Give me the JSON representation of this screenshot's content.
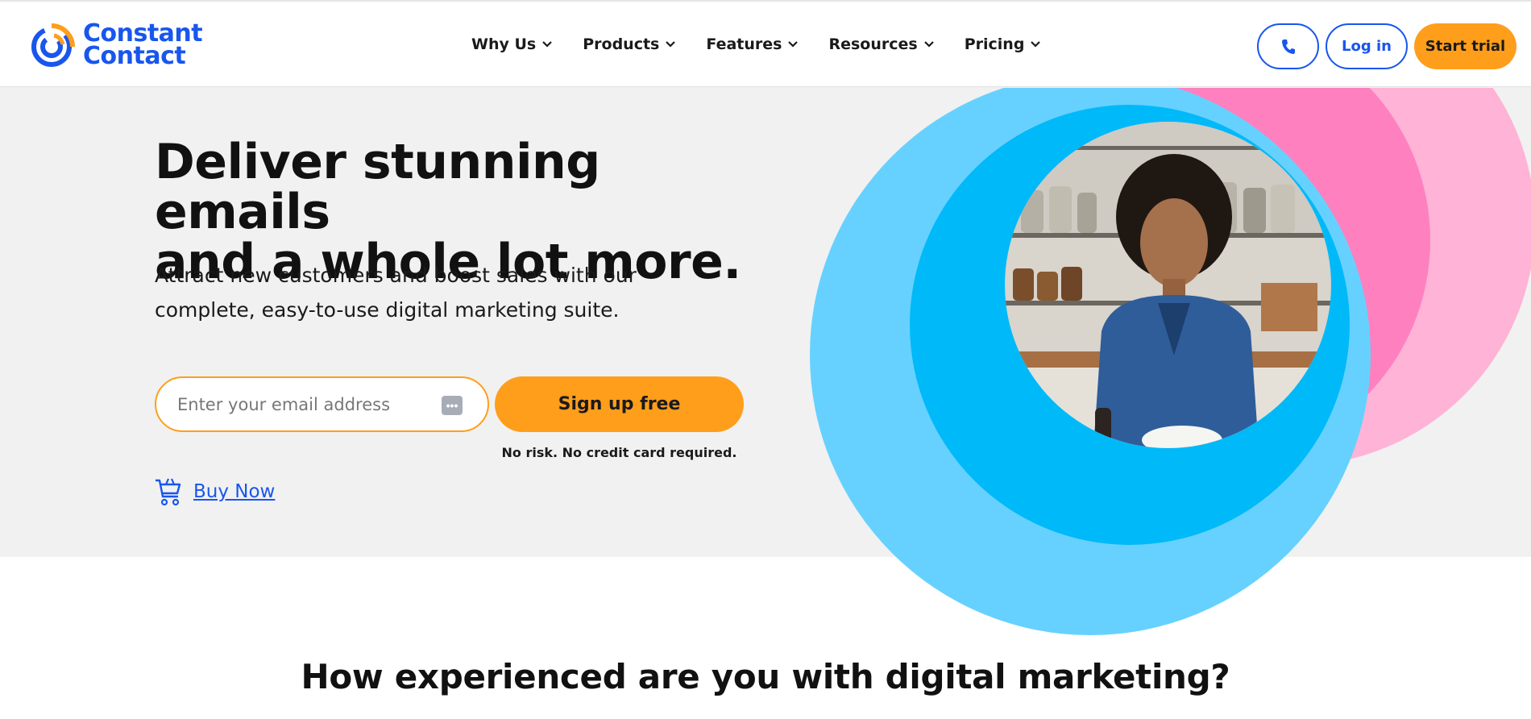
{
  "brand": {
    "name_line1": "Constant",
    "name_line2": "Contact",
    "colors": {
      "blue": "#1856ed",
      "orange": "#ff9e1b",
      "pink": "#ff80bf",
      "light_pink": "#ffb3d6",
      "cyan": "#00b9f8",
      "light_cyan": "#66d1ff"
    }
  },
  "nav": {
    "items": [
      {
        "label": "Why Us"
      },
      {
        "label": "Products"
      },
      {
        "label": "Features"
      },
      {
        "label": "Resources"
      },
      {
        "label": "Pricing"
      }
    ]
  },
  "header_actions": {
    "phone_icon": "phone-icon",
    "login_label": "Log in",
    "trial_label": "Start trial"
  },
  "hero": {
    "headline_line1": "Deliver stunning emails",
    "headline_line2": "and a whole lot more.",
    "subhead_line1": "Attract new customers and boost sales with our",
    "subhead_line2": "complete, easy-to-use digital marketing suite.",
    "email_placeholder": "Enter your email address",
    "signup_label": "Sign up free",
    "no_risk": "No risk. No credit card required.",
    "buy_now": "Buy Now"
  },
  "next_section": {
    "title": "How experienced are you with digital marketing?"
  }
}
